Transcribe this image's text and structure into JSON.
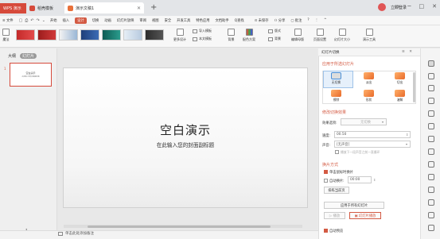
{
  "titlebar": {
    "tabs": [
      {
        "label": "WPS 演示",
        "color": "#d64a3b"
      },
      {
        "label": "稻壳模板",
        "color": "#d64a3b"
      },
      {
        "label": "演示文稿1",
        "color": "#e8703a"
      }
    ],
    "new_tab": "+",
    "login": "立即登录",
    "window_controls": [
      "▭",
      "─",
      "□",
      "✕"
    ]
  },
  "menubar": {
    "file": "≡ 文件",
    "quick_icons": [
      "▢",
      "⎙",
      "↶",
      "↷",
      "⌄"
    ],
    "items": [
      "开始",
      "插入",
      "设计",
      "切换",
      "动画",
      "幻灯片放映",
      "审阅",
      "视图",
      "安全",
      "开发工具",
      "特色应用",
      "文档助手",
      "Q查找"
    ],
    "active": "设计",
    "right_items": [
      "⊙ 未保存",
      "⚇ 分享",
      "▢ 批注",
      "?",
      "⋮",
      "^"
    ]
  },
  "ribbon": {
    "left_btn": "魔法",
    "more_design": "更多设计",
    "import_template": "导入模板",
    "text_template": "本文模板",
    "bg": "背景",
    "color_scheme": "配色方案",
    "format": "版式",
    "bg_btn": "背景",
    "edit_mother": "编辑母版",
    "page_setup": "页面设置",
    "slide_size": "幻灯片大小",
    "design_tools": "演示工具"
  },
  "left_panel": {
    "tabs": [
      "大纲",
      "幻灯片"
    ],
    "slide_num": "1",
    "thumb_title": "空白演示",
    "thumb_sub": "在此输入您的封面副标题",
    "add": "+"
  },
  "slide": {
    "title": "空白演示",
    "subtitle": "在此输入您的封面副标题"
  },
  "status": {
    "note": "单击此处添加备注"
  },
  "right_panel": {
    "header": "幻灯片切换",
    "controls": "≡ ✕",
    "section_apply": "应用于所选幻灯片",
    "transitions": [
      "无切换",
      "淡出",
      "切出",
      "擦除",
      "形状",
      "溶解"
    ],
    "section_modify": "修改切换效果",
    "effect_label": "效果选项:",
    "effect_value": "无切换",
    "speed_label": "速度:",
    "speed_value": "00.50",
    "sound_label": "声音:",
    "sound_value": "[无声音]",
    "loop_label": "播放下一段声音之前一直循环",
    "section_advance": "换片方式",
    "click_label": "单击鼠标时换片",
    "auto_label": "自动换片:",
    "auto_value": "00:00",
    "rehearse": "排练当前页",
    "apply_all": "应用于所有幻灯片",
    "play": "▷ 播放",
    "slideshow": "▣ 幻灯片播放",
    "autopreview": "自动预览"
  }
}
